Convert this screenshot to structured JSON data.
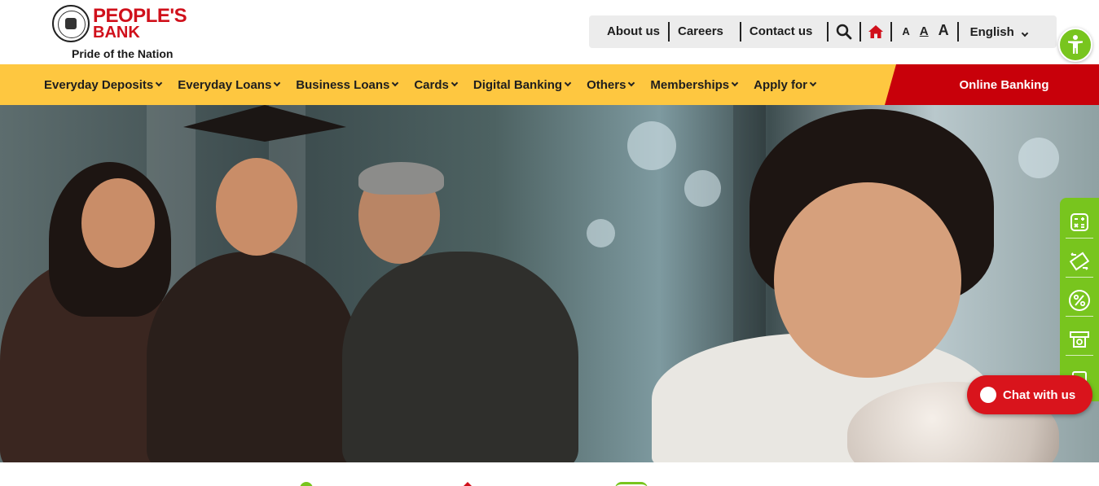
{
  "brand": {
    "name_line1": "PEOPLE'S",
    "name_line2": "BANK",
    "tagline": "Pride of the Nation",
    "color": "#d0101b"
  },
  "topbar": {
    "links": [
      "About us",
      "Careers",
      "Contact us"
    ],
    "search_icon": "search-icon",
    "home_icon": "home-icon",
    "font_sizes": [
      "A",
      "A",
      "A"
    ],
    "language": "English"
  },
  "accessibility_icon": "accessibility-icon",
  "nav": {
    "items": [
      "Everyday Deposits",
      "Everyday Loans",
      "Business Loans",
      "Cards",
      "Digital Banking",
      "Others",
      "Memberships",
      "Apply for"
    ],
    "online_banking": "Online Banking",
    "bar_color": "#fec740",
    "cta_color": "#c8000a"
  },
  "side_tools": {
    "icons": [
      "calculator-icon",
      "exchange-icon",
      "percent-icon",
      "atm-icon",
      "more-icon"
    ],
    "color": "#78c51e"
  },
  "chat": {
    "label": "Chat with us",
    "color": "#d9141c"
  }
}
